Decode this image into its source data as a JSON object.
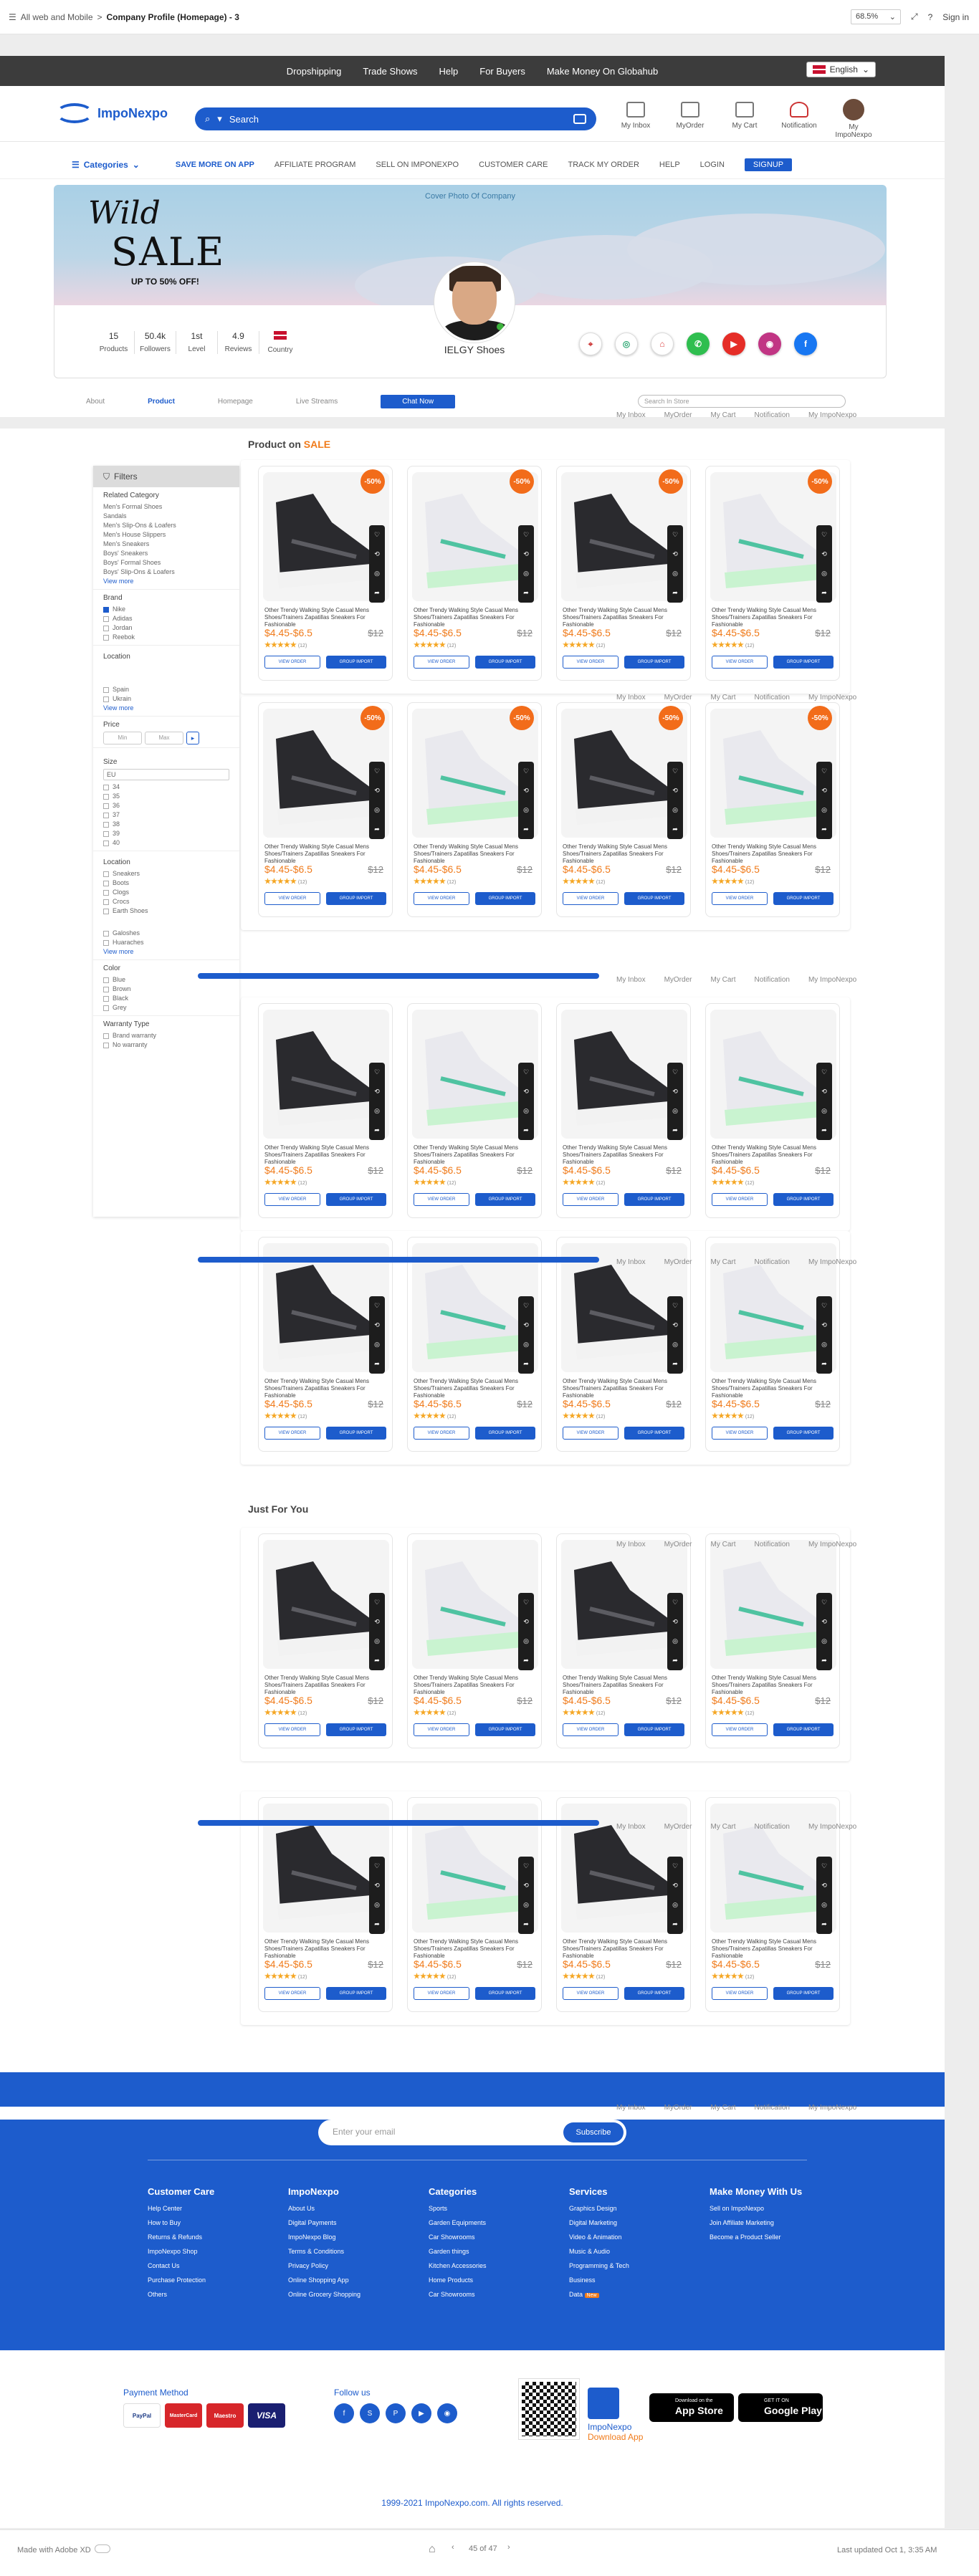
{
  "xd": {
    "crumb_root": "All web and Mobile",
    "crumb_sep": ">",
    "crumb_title": "Company Profile (Homepage) - 3",
    "zoom": "68.5%",
    "sign_in": "Sign in",
    "made_with": "Made with Adobe XD",
    "pager": "45 of 47",
    "last_updated": "Last updated Oct 1, 3:35 AM"
  },
  "topnav": {
    "items": [
      "Dropshipping",
      "Trade Shows",
      "Help",
      "For Buyers",
      "Make Money On Globahub"
    ],
    "language": "English"
  },
  "header": {
    "logo": "ImpoNexpo",
    "search_placeholder": "Search",
    "icons": [
      {
        "label": "My Inbox",
        "icon": "inbox-icon"
      },
      {
        "label": "MyOrder",
        "icon": "order-icon"
      },
      {
        "label": "My Cart",
        "icon": "cart-icon"
      },
      {
        "label": "Notification",
        "icon": "bell-icon"
      },
      {
        "label": "My ImpoNexpo",
        "icon": "avatar"
      }
    ]
  },
  "catnav": {
    "categories": "Categories",
    "items": [
      "SAVE MORE ON APP",
      "AFFILIATE PROGRAM",
      "SELL ON IMPONEXPO",
      "CUSTOMER CARE",
      "TRACK MY ORDER",
      "HELP",
      "LOGIN"
    ],
    "signup": "SIGNUP"
  },
  "cover": {
    "caption": "Cover Photo Of Company",
    "wild": "Wild",
    "sale": "SALE",
    "upto": "UP TO 50% OFF!"
  },
  "profile": {
    "stats": [
      {
        "value": "15",
        "label": "Products"
      },
      {
        "value": "50.4k",
        "label": "Followers"
      },
      {
        "value": "1st",
        "label": "Level"
      },
      {
        "value": "4.9",
        "label": "Reviews"
      },
      {
        "value": "",
        "label": "Country"
      }
    ],
    "shop_name": "IELGY Shoes",
    "socials": [
      "location",
      "chrome",
      "store",
      "whatsapp",
      "youtube",
      "instagram",
      "facebook"
    ]
  },
  "tabs": {
    "items": [
      "About",
      "Product",
      "Homepage",
      "Live Streams"
    ],
    "chat": "Chat Now",
    "search_placeholder": "Search In Store"
  },
  "sections": {
    "sale_prefix": "Product on",
    "sale_word": "SALE",
    "just_for_you": "Just For You"
  },
  "filters": {
    "title": "Filters",
    "related_category": "Related Category",
    "categories": [
      "Men's Formal Shoes",
      "Sandals",
      "Men's Slip-Ons & Loafers",
      "Men's House Slippers",
      "Men's Sneakers",
      "Boys' Sneakers",
      "Boys' Formal Shoes",
      "Boys' Slip-Ons & Loafers"
    ],
    "view_more": "View more",
    "brand": "Brand",
    "brands": [
      "Nike",
      "Adidas",
      "Jordan",
      "Reebok"
    ],
    "location": "Location",
    "locations": [
      "Spain",
      "Ukrain"
    ],
    "price": "Price",
    "price_min": "Min",
    "price_max": "Max",
    "size": "Size",
    "size_selected": "EU",
    "sizes": [
      "34",
      "35",
      "36",
      "37",
      "38",
      "39",
      "40"
    ],
    "location2": "Location",
    "types": [
      "Sneakers",
      "Boots",
      "Clogs",
      "Crocs",
      "Earth Shoes"
    ],
    "types2": [
      "Galoshes",
      "Huaraches"
    ],
    "color": "Color",
    "colors": [
      "Blue",
      "Brown",
      "Black",
      "Grey"
    ],
    "warranty": "Warranty Type",
    "warranties": [
      "Brand warranty",
      "No warranty"
    ]
  },
  "product": {
    "title": "Other Trendy Walking Style Casual Mens Shoes/Trainers Zapatillas Sneakers For Fashionable",
    "price": "$4.45-$6.5",
    "old_price": "$12",
    "rating": "★★★★★",
    "reviews": "(12)",
    "discount": "-50%",
    "btn_view": "VIEW ORDER",
    "btn_group": "GROUP IMPORT"
  },
  "artboard_labels": [
    "My Inbox",
    "MyOrder",
    "My Cart",
    "Notification",
    "My ImpoNexpo"
  ],
  "footer": {
    "email_placeholder": "Enter your email",
    "subscribe": "Subscribe",
    "columns": [
      {
        "title": "Customer Care",
        "links": [
          "Help Center",
          "How to Buy",
          "Returns & Refunds",
          "ImpoNexpo Shop",
          "Contact Us",
          "Purchase Protection",
          "Others"
        ]
      },
      {
        "title": "ImpoNexpo",
        "links": [
          "About Us",
          "Digital Payments",
          "ImpoNexpo Blog",
          "Terms & Conditions",
          "Privacy Policy",
          "Online Shopping App",
          "Online Grocery Shopping"
        ]
      },
      {
        "title": "Categories",
        "links": [
          "Sports",
          "Garden Equipments",
          "Car Showrooms",
          "Garden things",
          "Kitchen Accessories",
          "Home Products",
          "Car Showrooms"
        ]
      },
      {
        "title": "Services",
        "links": [
          "Graphics Design",
          "Digital Marketing",
          "Video & Animation",
          "Music & Audio",
          "Programming & Tech",
          "Business",
          "Data"
        ]
      },
      {
        "title": "Make Money With Us",
        "links": [
          "Sell on ImpoNexpo",
          "Join Affiliate Marketing",
          "Become a Product Seller"
        ]
      }
    ],
    "new_badge": "New",
    "payment_method": "Payment Method",
    "payments": [
      "PayPal",
      "MasterCard",
      "Maestro",
      "VISA"
    ],
    "follow_us": "Follow us",
    "app_name": "ImpoNexpo",
    "download": "Download App",
    "app_store_small": "Download on the",
    "app_store": "App Store",
    "play_small": "GET IT ON",
    "play": "Google Play",
    "copyright": "1999-2021 ImpoNexpo.com. All rights reserved."
  },
  "colors": {
    "brand": "#1d5ccc",
    "accent": "#f07b1b",
    "dark_nav": "#3c3c3c"
  }
}
